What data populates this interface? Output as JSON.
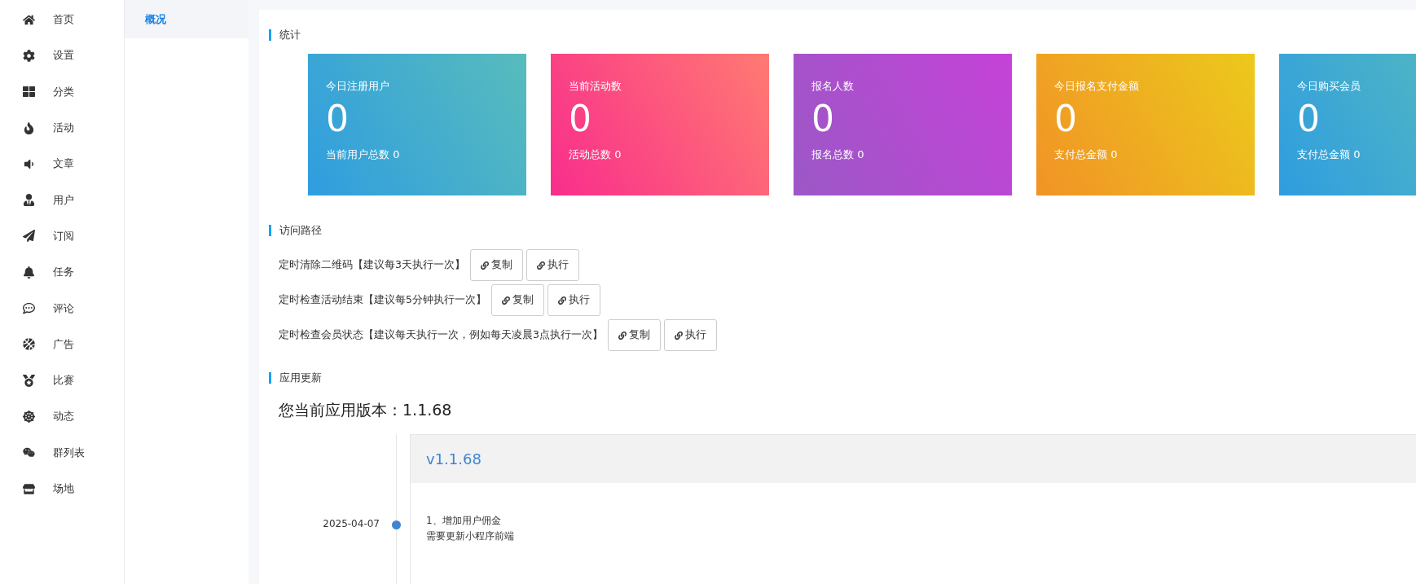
{
  "sidebar": {
    "items": [
      {
        "label": "首页"
      },
      {
        "label": "设置"
      },
      {
        "label": "分类"
      },
      {
        "label": "活动"
      },
      {
        "label": "文章"
      },
      {
        "label": "用户"
      },
      {
        "label": "订阅"
      },
      {
        "label": "任务"
      },
      {
        "label": "评论"
      },
      {
        "label": "广告"
      },
      {
        "label": "比赛"
      },
      {
        "label": "动态"
      },
      {
        "label": "群列表"
      },
      {
        "label": "场地"
      }
    ]
  },
  "submenu": {
    "items": [
      {
        "label": "概况",
        "selected": true
      }
    ]
  },
  "statistics": {
    "title": "统计",
    "cards": [
      {
        "title": "今日注册用户",
        "value": "0",
        "footer": "当前用户总数 0"
      },
      {
        "title": "当前活动数",
        "value": "0",
        "footer": "活动总数 0"
      },
      {
        "title": "报名人数",
        "value": "0",
        "footer": "报名总数 0"
      },
      {
        "title": "今日报名支付金额",
        "value": "0",
        "footer": "支付总金额 0"
      },
      {
        "title": "今日购买会员",
        "value": "0",
        "footer": "支付总金额 0"
      }
    ]
  },
  "access_paths": {
    "title": "访问路径",
    "rows": [
      {
        "label": "定时清除二维码【建议每3天执行一次】",
        "buttons": [
          "复制",
          "执行"
        ]
      },
      {
        "label": "定时检查活动结束【建议每5分钟执行一次】",
        "buttons": [
          "复制",
          "执行"
        ]
      },
      {
        "label": "定时检查会员状态【建议每天执行一次，例如每天凌晨3点执行一次】",
        "buttons": [
          "复制",
          "执行"
        ]
      }
    ]
  },
  "app_update": {
    "title": "应用更新",
    "current_version": "您当前应用版本：1.1.68",
    "timeline": [
      {
        "date": "2025-04-07",
        "version": "v1.1.68",
        "notes": [
          "1、增加用户佣金",
          "需要更新小程序前端"
        ]
      }
    ]
  }
}
